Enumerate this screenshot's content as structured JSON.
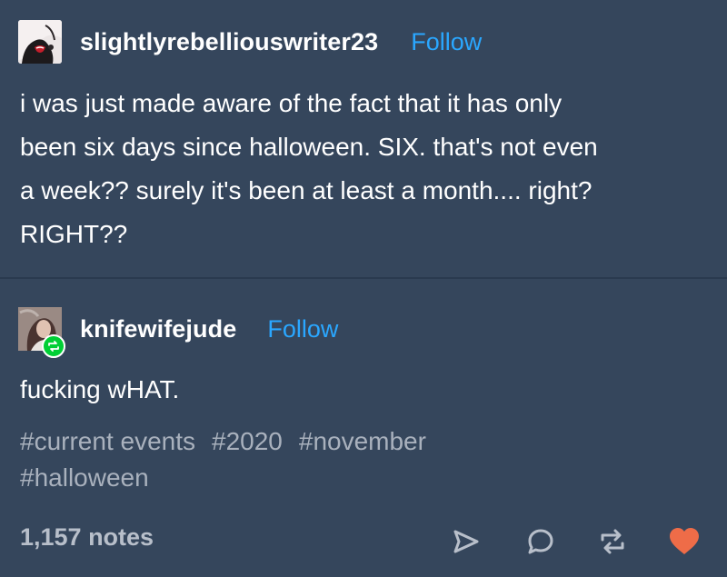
{
  "post": {
    "original": {
      "username": "slightlyrebelliouswriter23",
      "follow_label": "Follow",
      "lines": [
        "i was just made aware of the fact that it has only",
        "been six days since halloween. SIX. that's not even",
        "a week?? surely it's been at least a month.... right?",
        "RIGHT??"
      ]
    },
    "reblog": {
      "username": "knifewifejude",
      "follow_label": "Follow",
      "text": "fucking wHAT."
    },
    "tags": [
      "#current events",
      "#2020",
      "#november",
      "#halloween"
    ],
    "notes": "1,157 notes",
    "icons": {
      "share": "paper-plane-icon",
      "reply": "speech-bubble-icon",
      "reblog": "reblog-arrows-icon",
      "like": "heart-icon"
    },
    "colors": {
      "background": "#35465c",
      "follow": "#2aa7ff",
      "heart": "#ee6c48",
      "reblog_badge": "#00cf35"
    }
  }
}
